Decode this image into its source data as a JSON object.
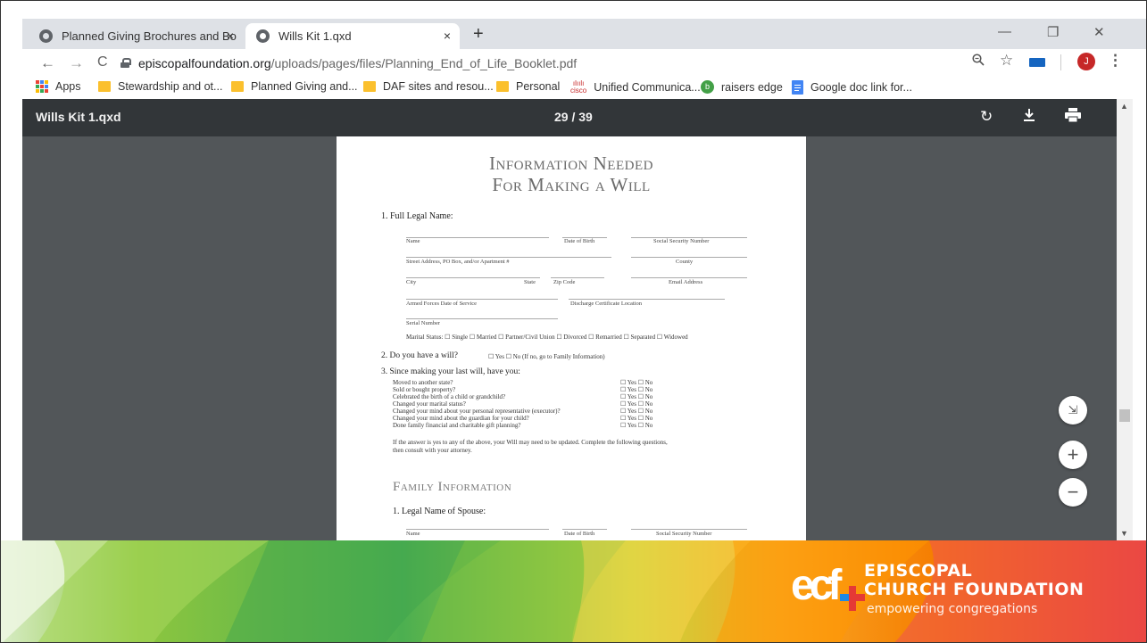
{
  "browser": {
    "tabs": [
      {
        "label": "Planned Giving Brochures and Bo",
        "close": "×"
      },
      {
        "label": "Wills Kit 1.qxd",
        "close": "×"
      }
    ],
    "new_tab": "+",
    "window_controls": {
      "minimize": "—",
      "restore": "❐",
      "close": "✕"
    },
    "nav": {
      "back": "←",
      "forward": "→",
      "reload": "C"
    },
    "url_domain": "episcopalfoundation.org",
    "url_path": "/uploads/pages/files/Planning_End_of_Life_Booklet.pdf",
    "profile_initial": "J",
    "bookmarks": [
      "Apps",
      "Stewardship and ot...",
      "Planned Giving and...",
      "DAF sites and resou...",
      "Personal",
      "Unified Communica...",
      "raisers edge",
      "Google doc link for..."
    ]
  },
  "pdf_viewer": {
    "title": "Wills Kit 1.qxd",
    "page_indicator": "29 / 39",
    "icons": [
      "rotate-icon",
      "download-icon",
      "print-icon"
    ],
    "zoom_controls": {
      "fit": "⇲",
      "zoom_in": "+",
      "zoom_out": "−"
    }
  },
  "document": {
    "heading_line1": "Information Needed",
    "heading_line2": "For Making a Will",
    "q1": "1. Full Legal Name:",
    "fields": {
      "name": "Name",
      "dob": "Date of Birth",
      "ssn": "Social Security Number",
      "street": "Street Address, PO Box, and/or Apartment #",
      "county": "County",
      "city": "City",
      "state": "State",
      "zip": "Zip Code",
      "email": "Email Address",
      "armed": "Armed Forces Date of Service",
      "discharge": "Discharge Certificate Location",
      "serial": "Serial Number"
    },
    "marital": "Marital Status: ☐ Single  ☐ Married  ☐ Partner/Civil Union  ☐ Divorced  ☐ Remarried  ☐ Separated  ☐ Widowed",
    "q2_label": "2.  Do you have a will?",
    "q2_options": "☐ Yes     ☐ No (If no, go to Family Information)",
    "q3_label": "3.  Since making your last will, have you:",
    "q3_items": [
      "Moved to another state?",
      "Sold or bought property?",
      "Celebrated the birth of a child or grandchild?",
      "Changed your marital status?",
      "Changed your mind about your personal representative (executor)?",
      "Changed your mind about the guardian for your child?",
      "Done family financial and charitable gift planning?"
    ],
    "yes_no": "☐ Yes    ☐ No",
    "note_line1": "If the answer is yes to any of the above, your Will may need to be updated. Complete the following questions,",
    "note_line2": "then consult with your attorney.",
    "section_family": "Family Information",
    "spouse_q": "1.  Legal Name of Spouse:",
    "spouse_fields": {
      "name": "Name",
      "dob": "Date of Birth",
      "ssn": "Social Security Number"
    }
  },
  "branding": {
    "logo_letters": "ecf",
    "org_line1": "EPISCOPAL",
    "org_line2": "CHURCH FOUNDATION",
    "tagline": "empowering congregations"
  },
  "colors": {
    "tabbar": "#dee1e6",
    "pdf_toolbar": "#323639",
    "pdf_background": "#525659",
    "logo_red": "#e53935",
    "logo_blue": "#1e88e5",
    "profile": "#c62828"
  }
}
